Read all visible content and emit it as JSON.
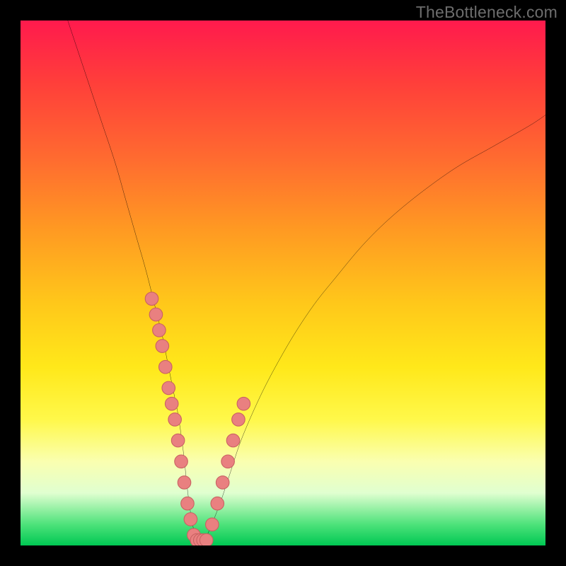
{
  "watermark": "TheBottleneck.com",
  "colors": {
    "frame": "#000000",
    "curve": "#000000",
    "dot_fill": "#e98080",
    "dot_stroke": "#c96262"
  },
  "chart_data": {
    "type": "line",
    "title": "",
    "xlabel": "",
    "ylabel": "",
    "xlim": [
      0,
      100
    ],
    "ylim": [
      0,
      100
    ],
    "grid": false,
    "series": [
      {
        "name": "bottleneck-curve",
        "x": [
          9,
          12,
          15,
          18,
          20,
          22,
          24,
          26,
          27,
          28,
          29,
          30,
          31,
          32,
          33,
          34,
          35,
          36,
          38,
          40,
          42,
          45,
          48,
          52,
          56,
          60,
          65,
          70,
          76,
          83,
          90,
          97,
          100
        ],
        "y": [
          100,
          91,
          82,
          73,
          66,
          59,
          52,
          44,
          40,
          35,
          30,
          25,
          18,
          9,
          3,
          1,
          1,
          3,
          8,
          14,
          20,
          27,
          33,
          40,
          46,
          51,
          57,
          62,
          67,
          72,
          76,
          80,
          82
        ]
      }
    ],
    "points": [
      {
        "name": "left-cluster",
        "x": [
          25.0,
          25.8,
          26.4,
          27.0,
          27.6,
          28.2,
          28.8,
          29.4,
          30.0,
          30.6,
          31.2,
          31.8,
          32.4,
          33.0
        ],
        "y": [
          47,
          44,
          41,
          38,
          34,
          30,
          27,
          24,
          20,
          16,
          12,
          8,
          5,
          2
        ]
      },
      {
        "name": "bottom-cluster",
        "x": [
          33.6,
          34.2,
          34.8,
          35.4
        ],
        "y": [
          1,
          1,
          1,
          1
        ]
      },
      {
        "name": "right-cluster",
        "x": [
          36.5,
          37.5,
          38.5,
          39.5,
          40.5,
          41.5,
          42.5
        ],
        "y": [
          4,
          8,
          12,
          16,
          20,
          24,
          27
        ]
      }
    ]
  }
}
